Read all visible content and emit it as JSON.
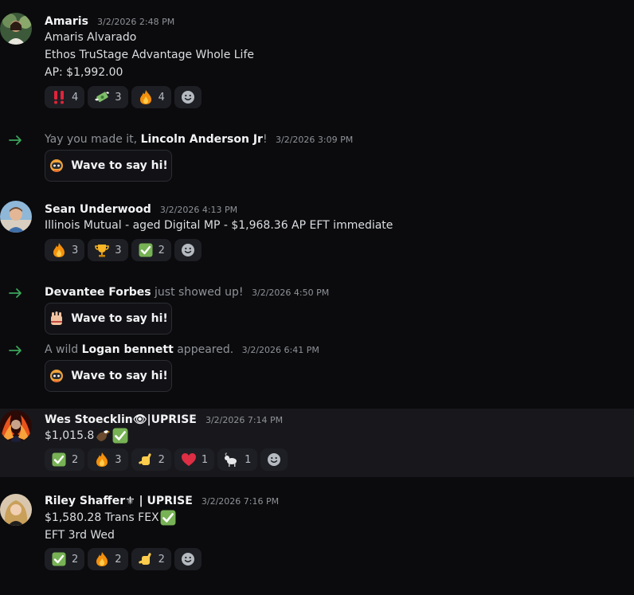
{
  "messages": {
    "amaris": {
      "author": "Amaris",
      "timestamp": "3/2/2026 2:48 PM",
      "lines": [
        "Amaris Alvarado",
        "Ethos TruStage Advantage Whole Life",
        "AP: $1,992.00"
      ],
      "reactions": [
        {
          "emoji": "double-exclamation",
          "count": "4"
        },
        {
          "emoji": "money-with-wings",
          "count": "3"
        },
        {
          "emoji": "fire",
          "count": "4"
        }
      ]
    },
    "sean": {
      "author": "Sean Underwood",
      "timestamp": "3/2/2026 4:13 PM",
      "lines": [
        "Illinois Mutual - aged Digital MP - $1,968.36 AP EFT immediate"
      ],
      "reactions": [
        {
          "emoji": "fire",
          "count": "3"
        },
        {
          "emoji": "trophy",
          "count": "3"
        },
        {
          "emoji": "check-mark",
          "count": "2"
        }
      ]
    },
    "wes": {
      "author": "Wes Stoecklin👁|UPRISE",
      "timestamp": "3/2/2026 7:14 PM",
      "lines": [
        "$1,015.8"
      ],
      "reactions": [
        {
          "emoji": "check-mark",
          "count": "2"
        },
        {
          "emoji": "fire",
          "count": "3"
        },
        {
          "emoji": "call-me-hand",
          "count": "2"
        },
        {
          "emoji": "red-heart",
          "count": "1"
        },
        {
          "emoji": "goat",
          "count": "1"
        }
      ]
    },
    "riley": {
      "author": "Riley Shaffer⚜ | UPRISE",
      "timestamp": "3/2/2026 7:16 PM",
      "lines": [
        "$1,580.28 Trans FEX",
        "EFT 3rd Wed"
      ],
      "reactions": [
        {
          "emoji": "check-mark",
          "count": "2"
        },
        {
          "emoji": "fire",
          "count": "2"
        },
        {
          "emoji": "call-me-hand",
          "count": "2"
        }
      ]
    }
  },
  "system": {
    "lincoln": {
      "prefix": "Yay you made it, ",
      "name": "Lincoln Anderson Jr",
      "suffix": "!",
      "timestamp": "3/2/2026 3:09 PM",
      "button": "Wave to say hi!"
    },
    "devantee": {
      "prefix": "",
      "name": "Devantee Forbes",
      "suffix": " just showed up!",
      "timestamp": "3/2/2026 4:50 PM",
      "button": "Wave to say hi!"
    },
    "logan": {
      "prefix": "A wild ",
      "name": "Logan bennett",
      "suffix": " appeared.",
      "timestamp": "3/2/2026 6:41 PM",
      "button": "Wave to say hi!"
    }
  },
  "colors": {
    "background": "#0b0b0d",
    "highlight_row": "#18181c",
    "reaction_bg": "#1e1f24",
    "join_arrow": "#3ba55c"
  }
}
